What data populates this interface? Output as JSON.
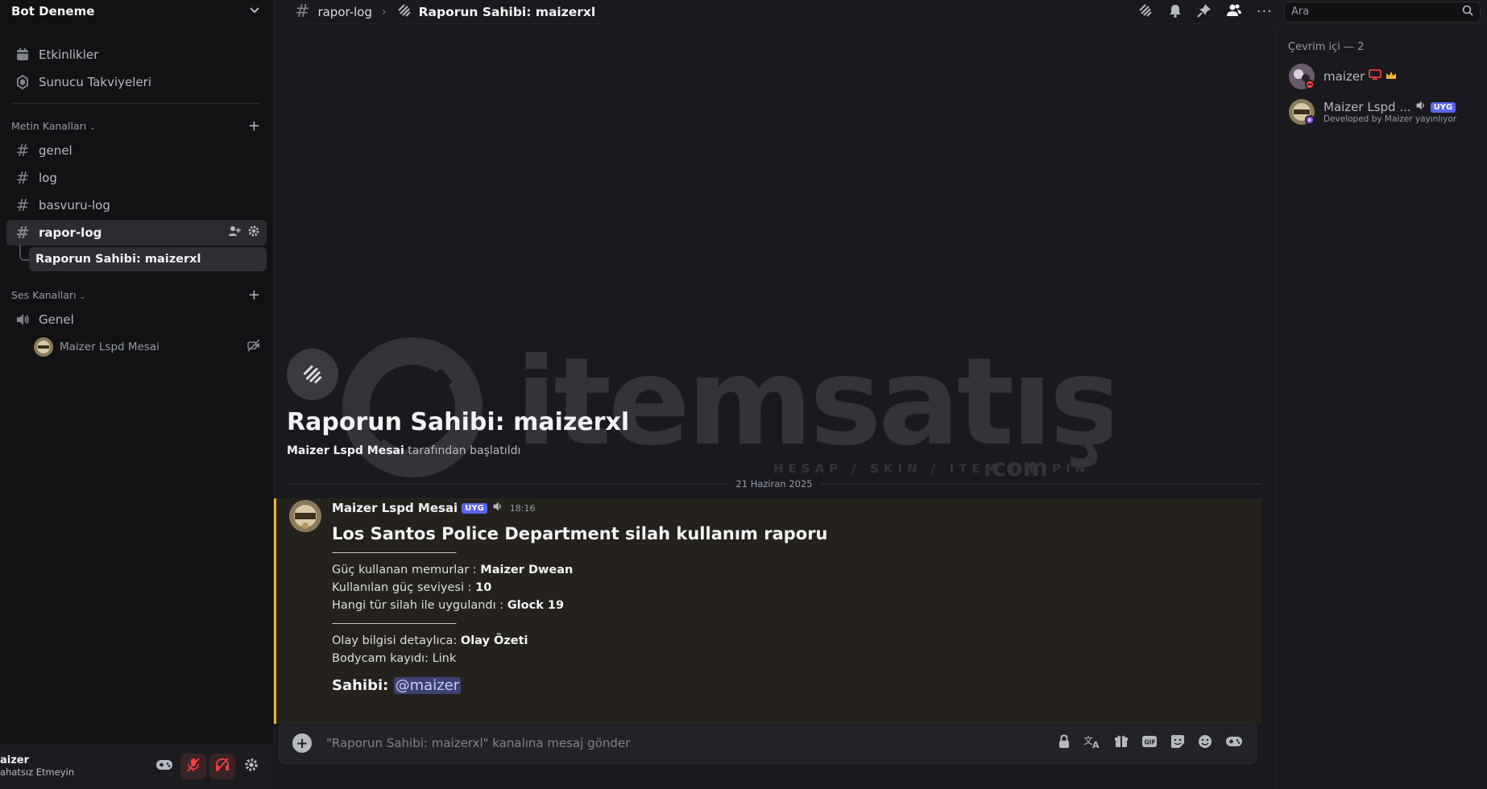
{
  "server": {
    "name": "Bot Deneme"
  },
  "sidebar": {
    "top_items": [
      {
        "label": "Etkinlikler",
        "icon": "calendar-icon"
      },
      {
        "label": "Sunucu Takviyeleri",
        "icon": "boost-icon"
      }
    ],
    "text_category": "Metin Kanalları",
    "text_channels": [
      "genel",
      "log",
      "basvuru-log",
      "rapor-log"
    ],
    "thread_label": "Raporun Sahibi: maizerxl",
    "voice_category": "Ses Kanalları",
    "voice_channel": "Genel",
    "voice_user": "Maizer Lspd Mesai"
  },
  "user_panel": {
    "name": "aizer",
    "status": "ahatsız Etmeyin"
  },
  "topbar": {
    "channel": "rapor-log",
    "thread_title": "Raporun Sahibi: maizerxl",
    "search_placeholder": "Ara"
  },
  "thread_start": {
    "title": "Raporun Sahibi: maizerxl",
    "starter": "Maizer Lspd Mesai",
    "starter_suffix": "tarafından başlatıldı"
  },
  "watermark": {
    "brand": "itemsatış",
    "tagline": "HESAP / SKIN / ITEM / E-PIN",
    "suffix": ".com"
  },
  "date_separator": "21 Haziran 2025",
  "message": {
    "author": "Maizer Lspd Mesai",
    "badge": "UYG",
    "time": "18:16",
    "title": "Los Santos Police Department silah kullanım raporu",
    "rule": "——————————————",
    "rows": [
      {
        "label": "Güç kullanan memurlar : ",
        "value": "Maizer Dwean"
      },
      {
        "label": "Kullanılan güç seviyesi : ",
        "value": "10"
      },
      {
        "label": "Hangi tür silah ile uygulandı : ",
        "value": "Glock 19"
      }
    ],
    "rows2": [
      {
        "label": "Olay bilgisi detaylıca: ",
        "value": "Olay Özeti"
      },
      {
        "label": "Bodycam kayıdı: ",
        "value": "Link"
      }
    ],
    "owner_label": "Sahibi:",
    "owner_mention": "@maizer"
  },
  "composer": {
    "placeholder": "\"Raporun Sahibi: maizerxl\" kanalına mesaj gönder",
    "gif_label": "GIF"
  },
  "members": {
    "header": "Çevrim içi — 2",
    "list": [
      {
        "name": "maizer",
        "subtitle": ""
      },
      {
        "name": "Maizer Lspd ...",
        "badge": "UYG",
        "subtitle": "Developed by Maizer yayınlıyor"
      }
    ]
  },
  "colors": {
    "accent": "#5865f2",
    "highlight": "#f0b232",
    "danger": "#f23f43",
    "bg": "#1a1a1e"
  }
}
